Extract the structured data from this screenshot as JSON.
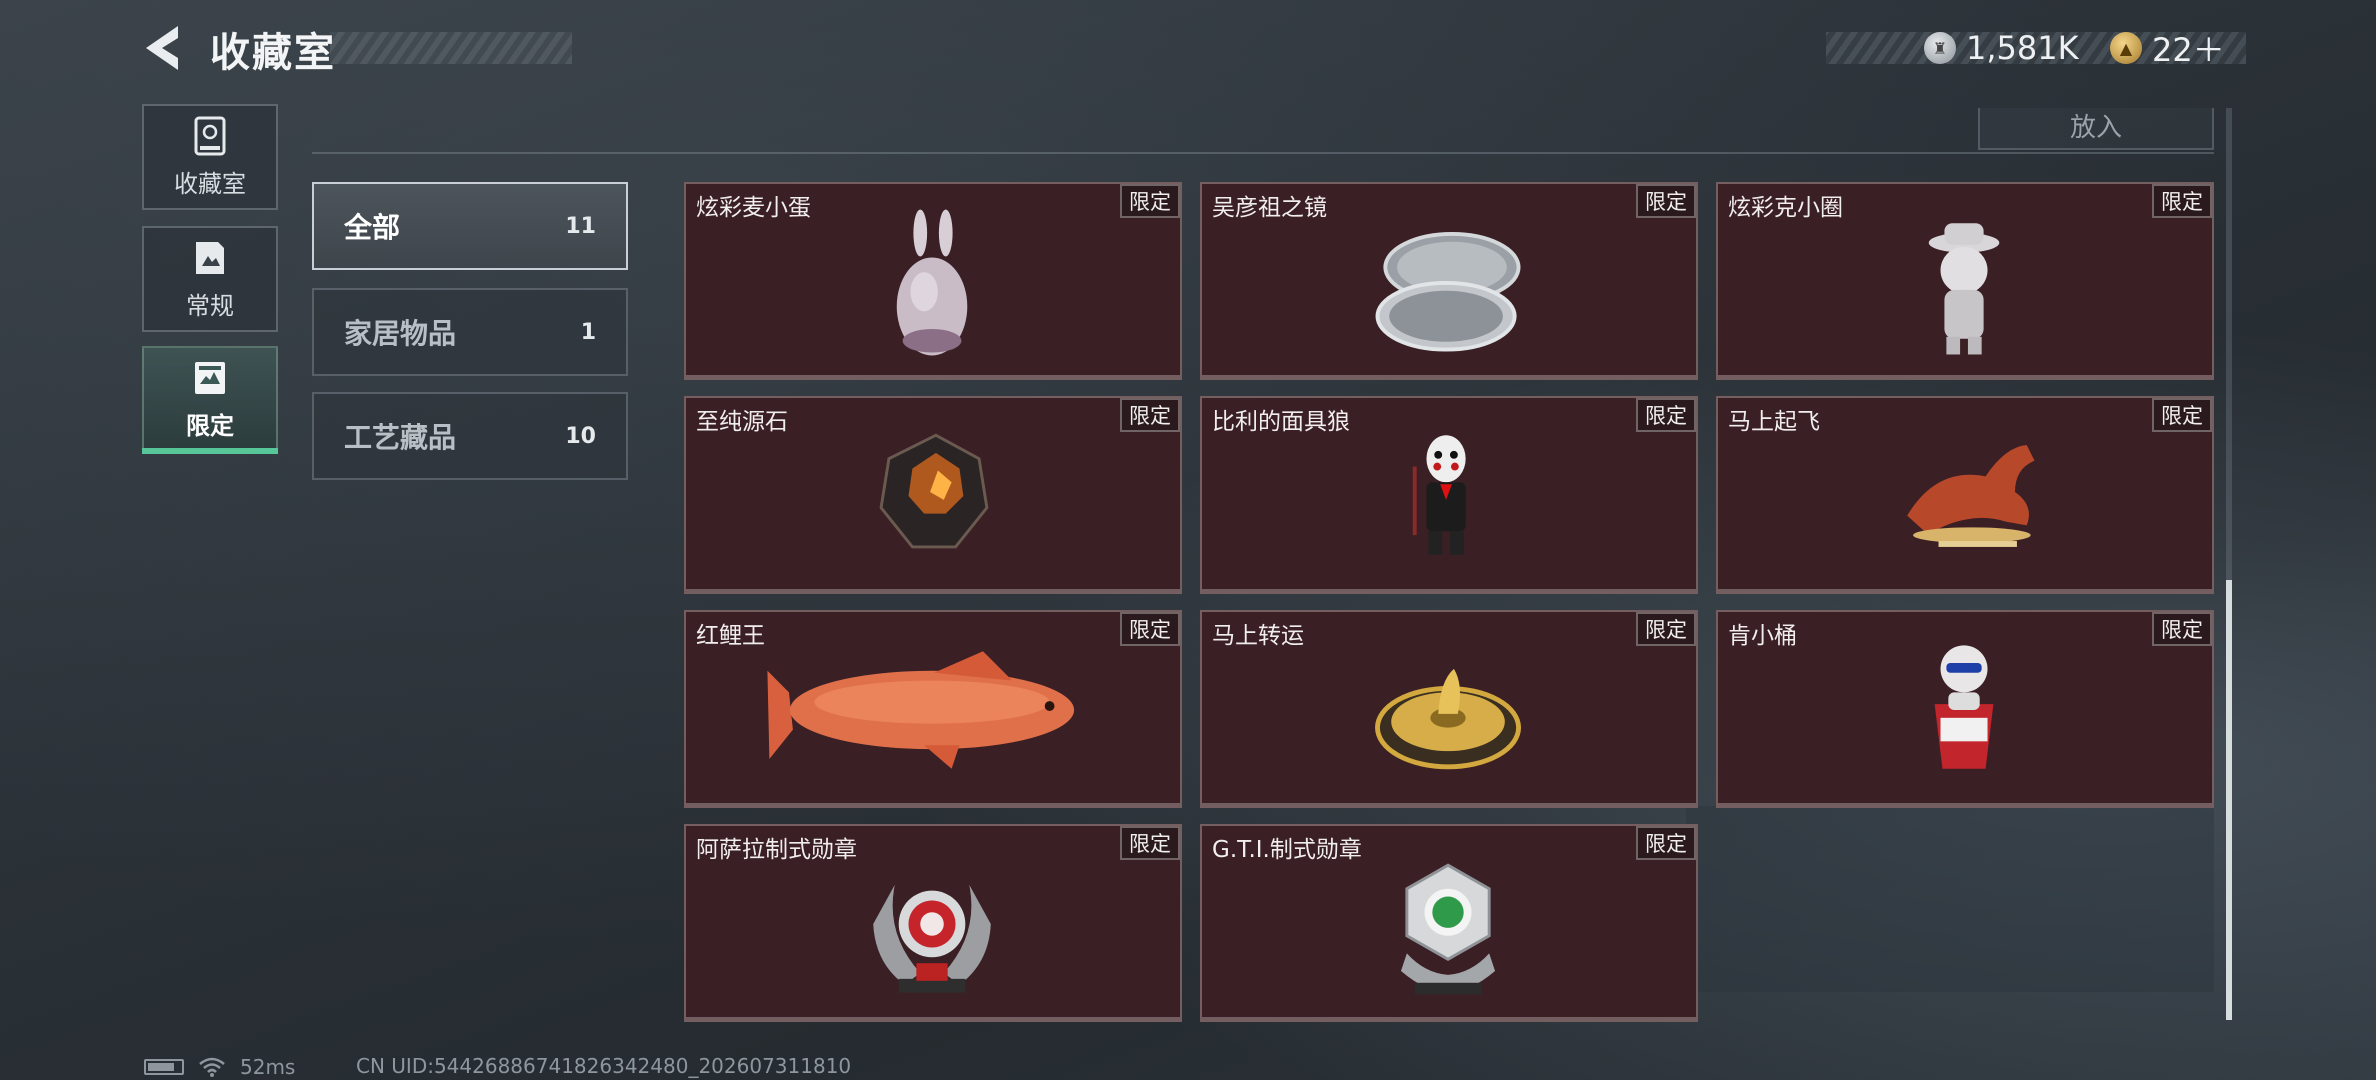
{
  "header": {
    "title": "收藏室",
    "currencies": [
      {
        "icon": "silver-coin-icon",
        "value": "1,581K"
      },
      {
        "icon": "gold-coin-icon",
        "value": "22＋"
      }
    ]
  },
  "categories": [
    {
      "label": "收藏室",
      "icon": "showcase-icon",
      "active": false
    },
    {
      "label": "常规",
      "icon": "document-icon",
      "active": false
    },
    {
      "label": "限定",
      "icon": "limited-icon",
      "active": true
    }
  ],
  "top": {
    "put_label": "放入"
  },
  "filters": [
    {
      "name": "全部",
      "count": "11",
      "active": true
    },
    {
      "name": "家居物品",
      "count": "1",
      "active": false
    },
    {
      "name": "工艺藏品",
      "count": "10",
      "active": false
    }
  ],
  "items": [
    {
      "name": "炫彩麦小蛋",
      "tag": "限定",
      "art": "egg-bunny"
    },
    {
      "name": "吴彦祖之镜",
      "tag": "限定",
      "art": "mirror"
    },
    {
      "name": "炫彩克小圈",
      "tag": "限定",
      "art": "figure-hat"
    },
    {
      "name": "至纯源石",
      "tag": "限定",
      "art": "gem"
    },
    {
      "name": "比利的面具狼",
      "tag": "限定",
      "art": "puppet"
    },
    {
      "name": "马上起飞",
      "tag": "限定",
      "art": "horse"
    },
    {
      "name": "红鲤王",
      "tag": "限定",
      "art": "carp"
    },
    {
      "name": "马上转运",
      "tag": "限定",
      "art": "compass"
    },
    {
      "name": "肯小桶",
      "tag": "限定",
      "art": "bucket-figure"
    },
    {
      "name": "阿萨拉制式勋章",
      "tag": "限定",
      "art": "medal-red"
    },
    {
      "name": "G.T.I.制式勋章",
      "tag": "限定",
      "art": "medal-green"
    }
  ],
  "footer": {
    "ping": "52ms",
    "uid": "CN UID:544268867418263424​80_202607311810"
  }
}
